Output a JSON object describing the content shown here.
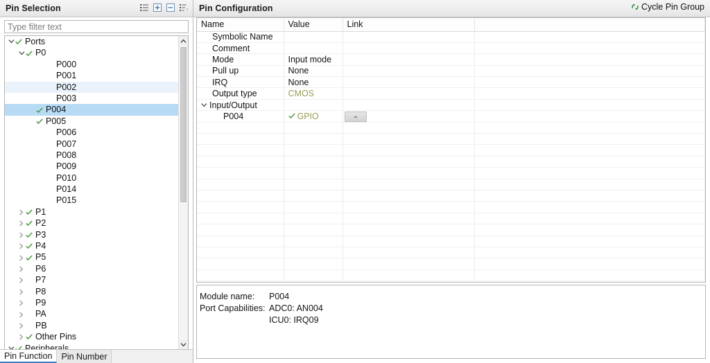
{
  "left_panel": {
    "title": "Pin Selection",
    "toolbar_icons": [
      {
        "name": "show-list-icon",
        "glyph": "list"
      },
      {
        "name": "expand-all-icon",
        "glyph": "plus-box"
      },
      {
        "name": "collapse-all-icon",
        "glyph": "minus-box"
      },
      {
        "name": "sort-icon",
        "glyph": "sort-az"
      }
    ],
    "filter": {
      "placeholder": "Type filter text",
      "value": ""
    },
    "tree": [
      {
        "label": "Ports",
        "indent": 0,
        "twisty": "down",
        "check": true,
        "state": "none"
      },
      {
        "label": "P0",
        "indent": 1,
        "twisty": "down",
        "check": true,
        "state": "none"
      },
      {
        "label": "P000",
        "indent": 3,
        "twisty": "none",
        "check": false,
        "state": "none"
      },
      {
        "label": "P001",
        "indent": 3,
        "twisty": "none",
        "check": false,
        "state": "none"
      },
      {
        "label": "P002",
        "indent": 3,
        "twisty": "none",
        "check": false,
        "state": "alt"
      },
      {
        "label": "P003",
        "indent": 3,
        "twisty": "none",
        "check": false,
        "state": "none"
      },
      {
        "label": "P004",
        "indent": 2,
        "twisty": "none",
        "check": true,
        "state": "sel"
      },
      {
        "label": "P005",
        "indent": 2,
        "twisty": "none",
        "check": true,
        "state": "none"
      },
      {
        "label": "P006",
        "indent": 3,
        "twisty": "none",
        "check": false,
        "state": "none"
      },
      {
        "label": "P007",
        "indent": 3,
        "twisty": "none",
        "check": false,
        "state": "none"
      },
      {
        "label": "P008",
        "indent": 3,
        "twisty": "none",
        "check": false,
        "state": "none"
      },
      {
        "label": "P009",
        "indent": 3,
        "twisty": "none",
        "check": false,
        "state": "none"
      },
      {
        "label": "P010",
        "indent": 3,
        "twisty": "none",
        "check": false,
        "state": "none"
      },
      {
        "label": "P014",
        "indent": 3,
        "twisty": "none",
        "check": false,
        "state": "none"
      },
      {
        "label": "P015",
        "indent": 3,
        "twisty": "none",
        "check": false,
        "state": "none"
      },
      {
        "label": "P1",
        "indent": 1,
        "twisty": "right",
        "check": true,
        "state": "none"
      },
      {
        "label": "P2",
        "indent": 1,
        "twisty": "right",
        "check": true,
        "state": "none"
      },
      {
        "label": "P3",
        "indent": 1,
        "twisty": "right",
        "check": true,
        "state": "none"
      },
      {
        "label": "P4",
        "indent": 1,
        "twisty": "right",
        "check": true,
        "state": "none"
      },
      {
        "label": "P5",
        "indent": 1,
        "twisty": "right",
        "check": true,
        "state": "none"
      },
      {
        "label": "P6",
        "indent": 1,
        "twisty": "right",
        "check": false,
        "state": "none"
      },
      {
        "label": "P7",
        "indent": 1,
        "twisty": "right",
        "check": false,
        "state": "none"
      },
      {
        "label": "P8",
        "indent": 1,
        "twisty": "right",
        "check": false,
        "state": "none"
      },
      {
        "label": "P9",
        "indent": 1,
        "twisty": "right",
        "check": false,
        "state": "none"
      },
      {
        "label": "PA",
        "indent": 1,
        "twisty": "right",
        "check": false,
        "state": "none"
      },
      {
        "label": "PB",
        "indent": 1,
        "twisty": "right",
        "check": false,
        "state": "none"
      },
      {
        "label": "Other Pins",
        "indent": 1,
        "twisty": "right",
        "check": true,
        "state": "none"
      },
      {
        "label": "Peripherals",
        "indent": 0,
        "twisty": "down",
        "check": true,
        "state": "none"
      }
    ],
    "tabs": [
      {
        "label": "Pin Function",
        "active": true
      },
      {
        "label": "Pin Number",
        "active": false
      }
    ]
  },
  "right_panel": {
    "title": "Pin Configuration",
    "cycle_link": {
      "label": "Cycle Pin Group",
      "icon": "recycle-icon",
      "color": "#2e8b3d"
    },
    "columns": [
      "Name",
      "Value",
      "Link"
    ],
    "rows": [
      {
        "name": "Symbolic Name",
        "indent": 1,
        "value": "",
        "value_style": "plain",
        "value_check": false,
        "link": "none",
        "twisty": "none"
      },
      {
        "name": "Comment",
        "indent": 1,
        "value": "",
        "value_style": "plain",
        "value_check": false,
        "link": "none",
        "twisty": "none"
      },
      {
        "name": "Mode",
        "indent": 1,
        "value": "Input mode",
        "value_style": "plain",
        "value_check": false,
        "link": "none",
        "twisty": "none"
      },
      {
        "name": "Pull up",
        "indent": 1,
        "value": "None",
        "value_style": "plain",
        "value_check": false,
        "link": "none",
        "twisty": "none"
      },
      {
        "name": "IRQ",
        "indent": 1,
        "value": "None",
        "value_style": "plain",
        "value_check": false,
        "link": "none",
        "twisty": "none"
      },
      {
        "name": "Output type",
        "indent": 1,
        "value": "CMOS",
        "value_style": "olive",
        "value_check": false,
        "link": "none",
        "twisty": "none"
      },
      {
        "name": "Input/Output",
        "indent": 0,
        "value": "",
        "value_style": "plain",
        "value_check": false,
        "link": "none",
        "twisty": "down"
      },
      {
        "name": "P004",
        "indent": 2,
        "value": "GPIO",
        "value_style": "olive",
        "value_check": true,
        "link": "button",
        "twisty": "none"
      }
    ],
    "empty_row_count": 14,
    "detail": {
      "module_name_label": "Module name:",
      "module_name_value": "P004",
      "capabilities_label": "Port Capabilities:",
      "capabilities_values": [
        "ADC0: AN004",
        "ICU0: IRQ09"
      ]
    }
  },
  "colors": {
    "selection": "#b8dbf5",
    "alt_row": "#eaf3fb",
    "check_green": "#4a9a3c",
    "olive_value": "#9b9b58",
    "tab_accent": "#3a7fc1"
  }
}
